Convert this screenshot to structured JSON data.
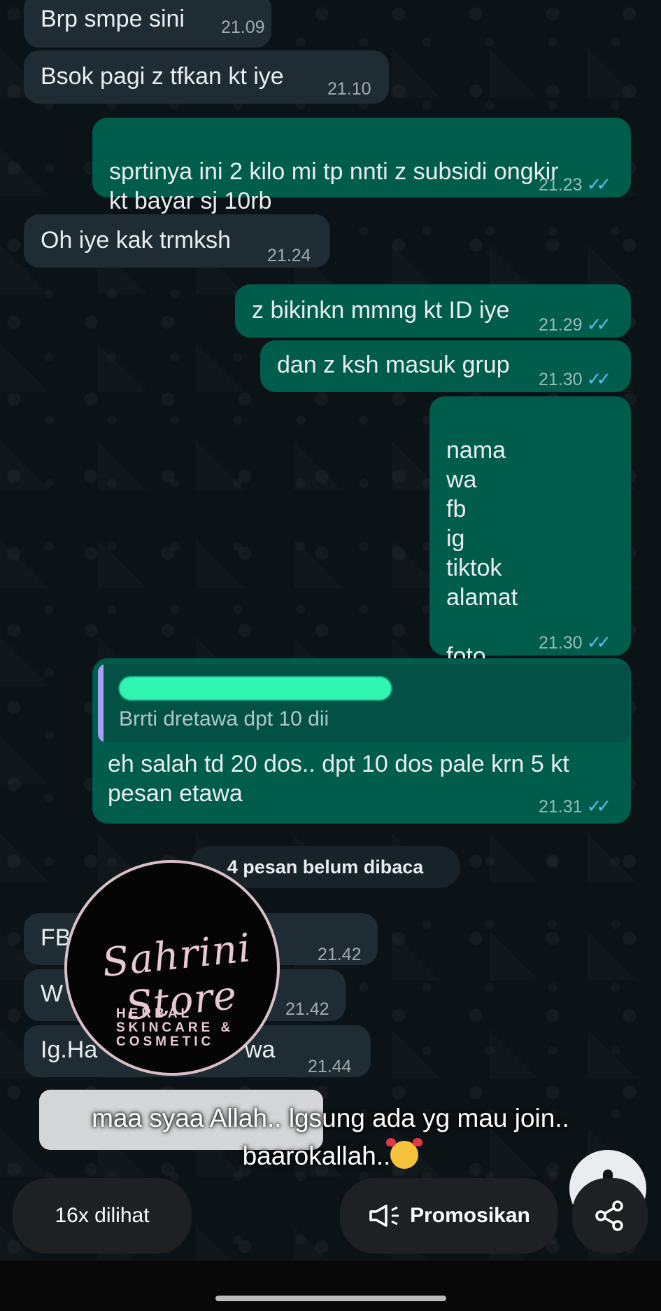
{
  "chat": {
    "messages": [
      {
        "side": "in",
        "text": "Brp smpe sini",
        "time": "21.09"
      },
      {
        "side": "in",
        "text": "Bsok pagi z tfkan kt iye",
        "time": "21.10"
      },
      {
        "side": "out",
        "text": "sprtinya ini 2 kilo mi tp nnti z subsidi ongkir\nkt bayar sj 10rb",
        "time": "21.23"
      },
      {
        "side": "in",
        "text": "Oh iye kak trmksh",
        "time": "21.24"
      },
      {
        "side": "out",
        "text": "z bikinkn mmng kt ID iye",
        "time": "21.29"
      },
      {
        "side": "out",
        "text": "dan z ksh masuk grup",
        "time": "21.30"
      },
      {
        "side": "out",
        "text": "nama\nwa\nfb\nig\ntiktok\nalamat\n\nfoto",
        "time": "21.30"
      },
      {
        "side": "out",
        "quote": "Brrti dretawa dpt 10 dii",
        "text": "eh salah td 20 dos.. dpt 10 dos pale krn 5 kt\npesan etawa",
        "time": "21.31"
      }
    ],
    "unread_label": "4 pesan belum dibaca",
    "after_unread": [
      {
        "text": "FB.",
        "time": "21.42"
      },
      {
        "text": "W",
        "time": "21.42"
      },
      {
        "text": "Ig.Ha",
        "tail": "wa",
        "time": "21.44"
      }
    ],
    "ticks": "✓✓"
  },
  "logo": {
    "script": "Sahrini Store",
    "tagline": "HERBAL\nSKINCARE &\nCOSMETIC"
  },
  "caption": {
    "line1": "maa syaa Allah.. lgsung ada yg mau join..",
    "line2": "baarokallah.."
  },
  "status_bar": {
    "views": "16x dilihat",
    "promote": "Promosikan"
  },
  "icons": {
    "promote": "megaphone-icon",
    "share": "share-icon",
    "ticks": "double-check-icon"
  },
  "colors": {
    "incoming": "#1f2c33",
    "outgoing": "#005c4b",
    "ticks": "#53bdeb"
  }
}
